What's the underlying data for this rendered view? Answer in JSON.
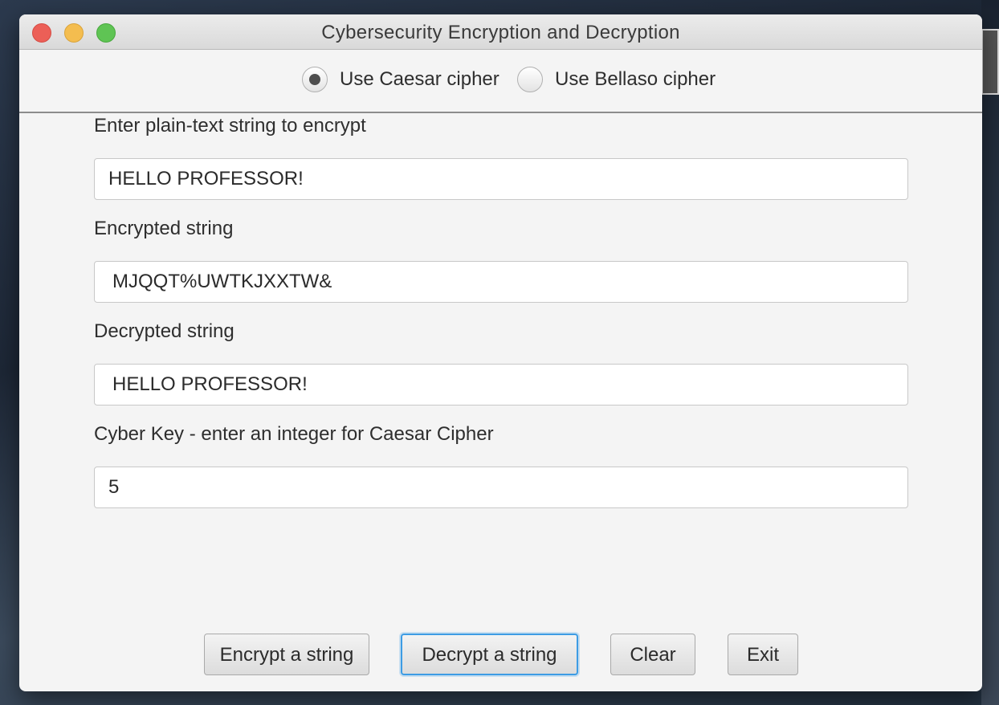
{
  "window": {
    "title": "Cybersecurity Encryption and Decryption"
  },
  "cipher_options": {
    "selected": "caesar",
    "caesar_label": "Use Caesar cipher",
    "bellaso_label": "Use Bellaso cipher"
  },
  "fields": {
    "plain_text": {
      "label": "Enter plain-text string to encrypt",
      "value": "HELLO PROFESSOR!"
    },
    "encrypted": {
      "label": "Encrypted string",
      "value": "MJQQT%UWTKJXXTW&"
    },
    "decrypted": {
      "label": "Decrypted string",
      "value": "HELLO PROFESSOR!"
    },
    "cyber_key": {
      "label": "Cyber Key - enter an integer for Caesar Cipher",
      "value": "5"
    }
  },
  "buttons": {
    "encrypt": "Encrypt a string",
    "decrypt": "Decrypt a string",
    "clear": "Clear",
    "exit": "Exit",
    "focused": "decrypt"
  },
  "colors": {
    "focus_ring": "#3d9ce4",
    "close": "#ec5f57",
    "minimize": "#f4bd4f",
    "maximize": "#5fc454"
  }
}
